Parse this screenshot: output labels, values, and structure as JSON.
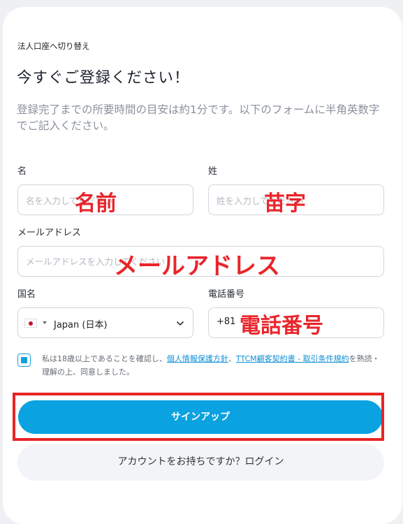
{
  "header": {
    "switch_link": "法人口座へ切り替え",
    "title": "今すぐご登録ください！",
    "description": "登録完了までの所要時間の目安は約1分です。以下のフォームに半角英数字でご記入ください。"
  },
  "form": {
    "first_name": {
      "label": "名",
      "placeholder": "名を入力してください",
      "annotation": "名前"
    },
    "last_name": {
      "label": "姓",
      "placeholder": "姓を入力してください",
      "annotation": "苗字"
    },
    "email": {
      "label": "メールアドレス",
      "placeholder": "メールアドレスを入力してください",
      "annotation": "メールアドレス"
    },
    "country": {
      "label": "国名",
      "value": "Japan (日本)",
      "flag_icon": "japan-flag-icon"
    },
    "phone": {
      "label": "電話番号",
      "prefix": "+81",
      "annotation": "電話番号"
    }
  },
  "consent": {
    "checked": true,
    "text_before": "私は18歳以上であることを確認し、",
    "link1": "個人情報保護方針",
    "separator": "、",
    "link2": "TTCM顧客契約書 - 取引条件規約",
    "text_after": "を熟読・理解の上、同意しました。"
  },
  "actions": {
    "signup": "サインアップ",
    "login": "アカウントをお持ちですか？ログイン"
  },
  "colors": {
    "primary": "#0aa2e0",
    "annotation": "#e8252b",
    "highlight_border": "#e82424"
  }
}
